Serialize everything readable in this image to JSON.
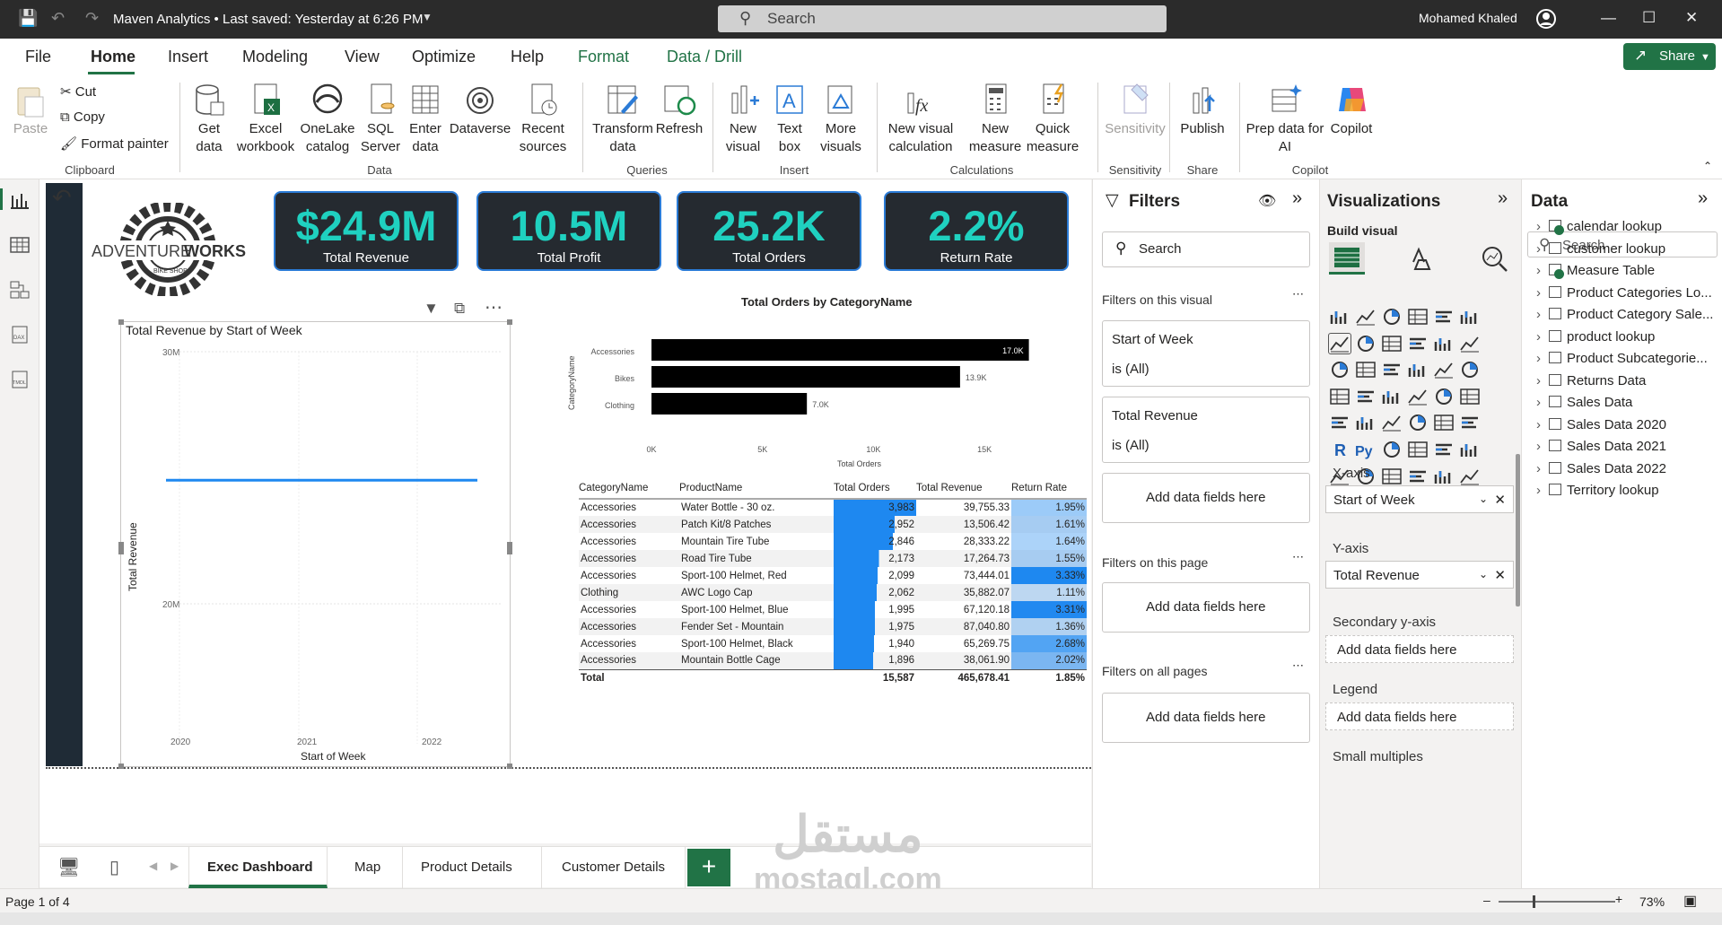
{
  "titlebar": {
    "title": "Maven Analytics • Last saved: Yesterday at 6:26 PM",
    "search_placeholder": "Search",
    "user": "Mohamed Khaled"
  },
  "ribbon_tabs": [
    "File",
    "Home",
    "Insert",
    "Modeling",
    "View",
    "Optimize",
    "Help",
    "Format",
    "Data / Drill"
  ],
  "share_label": "Share",
  "ribbon": {
    "paste": "Paste",
    "cut": "Cut",
    "copy": "Copy",
    "format_painter": "Format painter",
    "clipboard_group": "Clipboard",
    "get_data": "Get data",
    "excel": "Excel workbook",
    "onelake": "OneLake catalog",
    "sql": "SQL Server",
    "enter_data": "Enter data",
    "dataverse": "Dataverse",
    "recent": "Recent sources",
    "data_group": "Data",
    "transform": "Transform data",
    "refresh": "Refresh",
    "queries_group": "Queries",
    "new_visual": "New visual",
    "text_box": "Text box",
    "more_visuals": "More visuals",
    "insert_group": "Insert",
    "new_visual_calc": "New visual calculation",
    "new_measure": "New measure",
    "quick_measure": "Quick measure",
    "calc_group": "Calculations",
    "sensitivity": "Sensitivity",
    "sensitivity_group": "Sensitivity",
    "publish": "Publish",
    "share_group": "Share",
    "prep_data": "Prep data for AI",
    "copilot": "Copilot",
    "copilot_group": "Copilot"
  },
  "kpis": [
    {
      "value": "$24.9M",
      "label": "Total Revenue"
    },
    {
      "value": "10.5M",
      "label": "Total Profit"
    },
    {
      "value": "25.2K",
      "label": "Total Orders"
    },
    {
      "value": "2.2%",
      "label": "Return Rate"
    }
  ],
  "logo": {
    "text_left": "ADVENTURE",
    "text_right": "WORKS",
    "ring_text": "BIKE SHOP"
  },
  "line_chart": {
    "title": "Total Revenue by Start of Week",
    "ylabel": "Total Revenue",
    "xlabel": "Start of Week",
    "yticks": [
      "30M",
      "20M"
    ],
    "xticks": [
      "2020",
      "2021",
      "2022"
    ]
  },
  "chart_data": [
    {
      "type": "line",
      "title": "Total Revenue by Start of Week",
      "xlabel": "Start of Week",
      "ylabel": "Total Revenue",
      "x": [
        "2020",
        "2021",
        "2022"
      ],
      "ylim": [
        15000000,
        30000000
      ],
      "series": [
        {
          "values": [
            24900000,
            24900000,
            24900000
          ]
        }
      ]
    },
    {
      "type": "bar",
      "title": "Total Orders by CategoryName",
      "xlabel": "Total Orders",
      "ylabel": "CategoryName",
      "categories": [
        "Accessories",
        "Bikes",
        "Clothing"
      ],
      "values": [
        17000,
        13900,
        7000
      ],
      "data_labels": [
        "17.0K",
        "13.9K",
        "7.0K"
      ],
      "xticks": [
        "0K",
        "5K",
        "10K",
        "15K"
      ],
      "xlim": [
        0,
        17500
      ],
      "orientation": "horizontal",
      "color": "#000000"
    }
  ],
  "table": {
    "headers": [
      "CategoryName",
      "ProductName",
      "Total Orders",
      "Total Revenue",
      "Return Rate"
    ],
    "rows": [
      [
        "Accessories",
        "Water Bottle - 30 oz.",
        "3,983",
        "39,755.33",
        "1.95%"
      ],
      [
        "Accessories",
        "Patch Kit/8 Patches",
        "2,952",
        "13,506.42",
        "1.61%"
      ],
      [
        "Accessories",
        "Mountain Tire Tube",
        "2,846",
        "28,333.22",
        "1.64%"
      ],
      [
        "Accessories",
        "Road Tire Tube",
        "2,173",
        "17,264.73",
        "1.55%"
      ],
      [
        "Accessories",
        "Sport-100 Helmet, Red",
        "2,099",
        "73,444.01",
        "3.33%"
      ],
      [
        "Clothing",
        "AWC Logo Cap",
        "2,062",
        "35,882.07",
        "1.11%"
      ],
      [
        "Accessories",
        "Sport-100 Helmet, Blue",
        "1,995",
        "67,120.18",
        "3.31%"
      ],
      [
        "Accessories",
        "Fender Set - Mountain",
        "1,975",
        "87,040.80",
        "1.36%"
      ],
      [
        "Accessories",
        "Sport-100 Helmet, Black",
        "1,940",
        "65,269.75",
        "2.68%"
      ],
      [
        "Accessories",
        "Mountain Bottle Cage",
        "1,896",
        "38,061.90",
        "2.02%"
      ]
    ],
    "order_levels": [
      1.0,
      0.741,
      0.715,
      0.546,
      0.527,
      0.518,
      0.501,
      0.496,
      0.487,
      0.476
    ],
    "rate_levels": [
      0.25,
      0.15,
      0.16,
      0.13,
      1.0,
      0.0,
      0.99,
      0.08,
      0.7,
      0.41
    ],
    "total": [
      "Total",
      "",
      "15,587",
      "465,678.41",
      "1.85%"
    ]
  },
  "filters": {
    "title": "Filters",
    "search": "Search",
    "on_visual": "Filters on this visual",
    "f1_name": "Start of Week",
    "f1_val": "is (All)",
    "f2_name": "Total Revenue",
    "f2_val": "is (All)",
    "add": "Add data fields here",
    "on_page": "Filters on this page",
    "on_all": "Filters on all pages"
  },
  "viz": {
    "title": "Visualizations",
    "build": "Build visual",
    "xaxis": "X-axis",
    "xaxis_field": "Start of Week",
    "yaxis": "Y-axis",
    "yaxis_field": "Total Revenue",
    "secondary": "Secondary y-axis",
    "legend": "Legend",
    "small_multiples": "Small multiples",
    "add": "Add data fields here"
  },
  "data_pane": {
    "title": "Data",
    "search": "Search",
    "tables": [
      "calendar lookup",
      "customer lookup",
      "Measure Table",
      "Product Categories Lo...",
      "Product Category Sale...",
      "product lookup",
      "Product Subcategorie...",
      "Returns Data",
      "Sales Data",
      "Sales Data 2020",
      "Sales Data 2021",
      "Sales Data 2022",
      "Territory lookup"
    ]
  },
  "pages": [
    "Exec Dashboard",
    "Map",
    "Product Details",
    "Customer Details"
  ],
  "status": {
    "page": "Page 1 of 4",
    "zoom": "73%"
  },
  "watermark": {
    "ar": "مستقل",
    "en": "mostaql.com"
  },
  "colors": {
    "green": "#217346",
    "kpi_value": "#1fd1c0",
    "bar_blue": "#1e88f0",
    "line": "#1e88f0"
  }
}
